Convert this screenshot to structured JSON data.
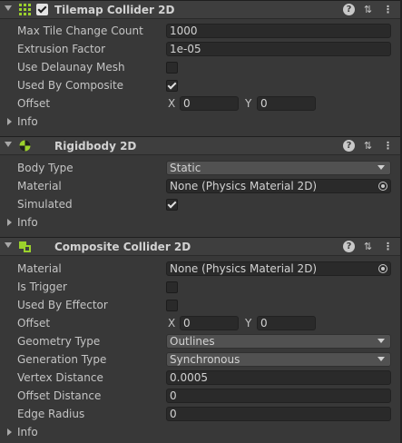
{
  "tilemap_collider": {
    "title": "Tilemap Collider 2D",
    "icon": "grid-icon",
    "enabled": true,
    "fields": {
      "max_tile_change_count": {
        "label": "Max Tile Change Count",
        "value": "1000"
      },
      "extrusion_factor": {
        "label": "Extrusion Factor",
        "value": "1e-05"
      },
      "use_delaunay_mesh": {
        "label": "Use Delaunay Mesh",
        "checked": false
      },
      "used_by_composite": {
        "label": "Used By Composite",
        "checked": true
      },
      "offset": {
        "label": "Offset",
        "x_label": "X",
        "x": "0",
        "y_label": "Y",
        "y": "0"
      },
      "info": {
        "label": "Info"
      }
    }
  },
  "rigidbody": {
    "title": "Rigidbody 2D",
    "icon": "rigidbody-icon",
    "fields": {
      "body_type": {
        "label": "Body Type",
        "value": "Static"
      },
      "material": {
        "label": "Material",
        "value": "None (Physics Material 2D)"
      },
      "simulated": {
        "label": "Simulated",
        "checked": true
      },
      "info": {
        "label": "Info"
      }
    }
  },
  "composite_collider": {
    "title": "Composite Collider 2D",
    "icon": "composite-collider-icon",
    "fields": {
      "material": {
        "label": "Material",
        "value": "None (Physics Material 2D)"
      },
      "is_trigger": {
        "label": "Is Trigger",
        "checked": false
      },
      "used_by_effector": {
        "label": "Used By Effector",
        "checked": false
      },
      "offset": {
        "label": "Offset",
        "x_label": "X",
        "x": "0",
        "y_label": "Y",
        "y": "0"
      },
      "geometry_type": {
        "label": "Geometry Type",
        "value": "Outlines"
      },
      "generation_type": {
        "label": "Generation Type",
        "value": "Synchronous"
      },
      "vertex_distance": {
        "label": "Vertex Distance",
        "value": "0.0005"
      },
      "offset_distance": {
        "label": "Offset Distance",
        "value": "0"
      },
      "edge_radius": {
        "label": "Edge Radius",
        "value": "0"
      },
      "info": {
        "label": "Info"
      }
    }
  },
  "colors": {
    "accent_green": "#9bd12c",
    "background": "#383838",
    "header": "#3e3e3e"
  }
}
